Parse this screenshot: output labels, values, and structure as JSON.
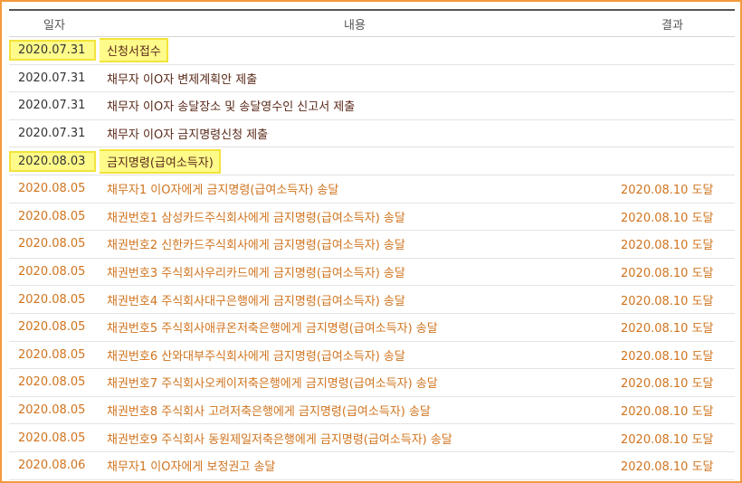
{
  "header": {
    "date": "일자",
    "content": "내용",
    "result": "결과"
  },
  "rows": [
    {
      "date": "2020.07.31",
      "content": "신청서접수",
      "result": ""
    },
    {
      "date": "2020.07.31",
      "content": "채무자 이O자 변제계획안 제출",
      "result": ""
    },
    {
      "date": "2020.07.31",
      "content": "채무자 이O자 송달장소 및 송달영수인 신고서 제출",
      "result": ""
    },
    {
      "date": "2020.07.31",
      "content": "채무자 이O자 금지명령신청 제출",
      "result": ""
    },
    {
      "date": "2020.08.03",
      "content": "금지명령(급여소득자)",
      "result": ""
    },
    {
      "date": "2020.08.05",
      "content": "채무자1 이O자에게 금지명령(급여소득자) 송달",
      "result": "2020.08.10 도달"
    },
    {
      "date": "2020.08.05",
      "content": "채권번호1 삼성카드주식회사에게 금지명령(급여소득자) 송달",
      "result": "2020.08.10 도달"
    },
    {
      "date": "2020.08.05",
      "content": "채권번호2 신한카드주식회사에게 금지명령(급여소득자) 송달",
      "result": "2020.08.10 도달"
    },
    {
      "date": "2020.08.05",
      "content": "채권번호3 주식회사우리카드에게 금지명령(급여소득자) 송달",
      "result": "2020.08.10 도달"
    },
    {
      "date": "2020.08.05",
      "content": "채권번호4 주식회사대구은행에게 금지명령(급여소득자) 송달",
      "result": "2020.08.10 도달"
    },
    {
      "date": "2020.08.05",
      "content": "채권번호5 주식회사애큐온저축은행에게 금지명령(급여소득자) 송달",
      "result": "2020.08.10 도달"
    },
    {
      "date": "2020.08.05",
      "content": "채권번호6 산와대부주식회사에게 금지명령(급여소득자) 송달",
      "result": "2020.08.10 도달"
    },
    {
      "date": "2020.08.05",
      "content": "채권번호7 주식회사오케이저축은행에게 금지명령(급여소득자) 송달",
      "result": "2020.08.10 도달"
    },
    {
      "date": "2020.08.05",
      "content": "채권번호8 주식회사 고려저축은행에게 금지명령(급여소득자) 송달",
      "result": "2020.08.10 도달"
    },
    {
      "date": "2020.08.05",
      "content": "채권번호9 주식회사 동원제일저축은행에게 금지명령(급여소득자) 송달",
      "result": "2020.08.10 도달"
    },
    {
      "date": "2020.08.06",
      "content": "채무자1 이O자에게 보정권고 송달",
      "result": "2020.08.10 도달"
    }
  ],
  "colors": {
    "border_accent": "#f39a3c",
    "highlight_fill": "#fffb8a",
    "highlight_outline": "#f2e33a",
    "delivery_text": "#d0741f",
    "filing_text": "#5a2a1a"
  }
}
